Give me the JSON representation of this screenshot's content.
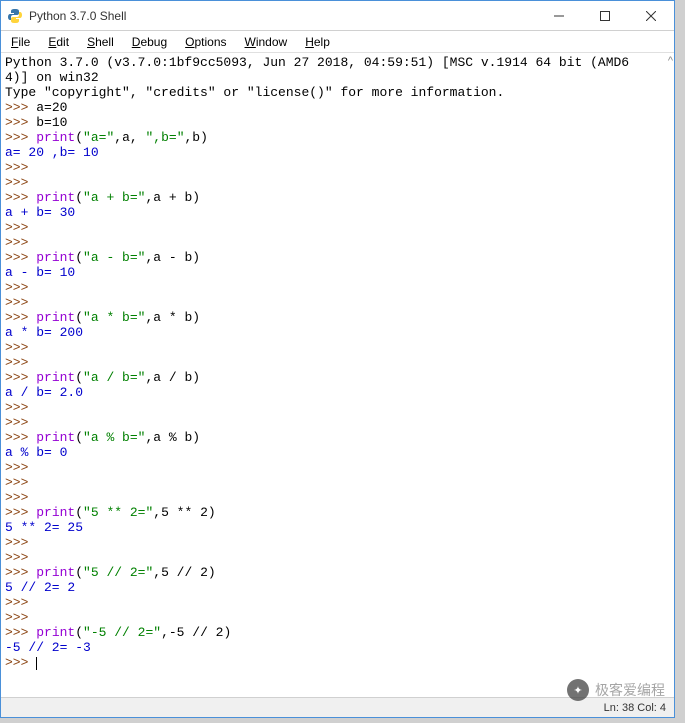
{
  "window": {
    "title": "Python 3.7.0 Shell"
  },
  "menu": {
    "items": [
      {
        "u": "F",
        "rest": "ile"
      },
      {
        "u": "E",
        "rest": "dit"
      },
      {
        "u": "S",
        "rest": "hell"
      },
      {
        "u": "D",
        "rest": "ebug"
      },
      {
        "u": "O",
        "rest": "ptions"
      },
      {
        "u": "W",
        "rest": "indow"
      },
      {
        "u": "H",
        "rest": "elp"
      }
    ]
  },
  "banner": {
    "l1": "Python 3.7.0 (v3.7.0:1bf9cc5093, Jun 27 2018, 04:59:51) [MSC v.1914 64 bit (AMD6",
    "l2": "4)] on win32",
    "l3": "Type \"copyright\", \"credits\" or \"license()\" for more information."
  },
  "session": [
    {
      "t": "in",
      "pre": ">>> ",
      "code": "a=20"
    },
    {
      "t": "in",
      "pre": ">>> ",
      "code": "b=10"
    },
    {
      "t": "in",
      "pre": ">>> ",
      "call": "print",
      "open": "(",
      "s1": "\"a=\"",
      "mid1": ",a, ",
      "s2": "\",b=\"",
      "mid2": ",b",
      "close": ")"
    },
    {
      "t": "out",
      "text": "a= 20 ,b= 10"
    },
    {
      "t": "in",
      "pre": ">>> ",
      "code": ""
    },
    {
      "t": "in",
      "pre": ">>> ",
      "code": ""
    },
    {
      "t": "in",
      "pre": ">>> ",
      "call": "print",
      "open": "(",
      "s1": "\"a + b=\"",
      "mid1": ",a + b",
      "close": ")"
    },
    {
      "t": "out",
      "text": "a + b= 30"
    },
    {
      "t": "in",
      "pre": ">>> ",
      "code": ""
    },
    {
      "t": "in",
      "pre": ">>> ",
      "code": ""
    },
    {
      "t": "in",
      "pre": ">>> ",
      "call": "print",
      "open": "(",
      "s1": "\"a - b=\"",
      "mid1": ",a - b",
      "close": ")"
    },
    {
      "t": "out",
      "text": "a - b= 10"
    },
    {
      "t": "in",
      "pre": ">>> ",
      "code": ""
    },
    {
      "t": "in",
      "pre": ">>> ",
      "code": ""
    },
    {
      "t": "in",
      "pre": ">>> ",
      "call": "print",
      "open": "(",
      "s1": "\"a * b=\"",
      "mid1": ",a * b",
      "close": ")"
    },
    {
      "t": "out",
      "text": "a * b= 200"
    },
    {
      "t": "in",
      "pre": ">>> ",
      "code": ""
    },
    {
      "t": "in",
      "pre": ">>> ",
      "code": ""
    },
    {
      "t": "in",
      "pre": ">>> ",
      "call": "print",
      "open": "(",
      "s1": "\"a / b=\"",
      "mid1": ",a / b",
      "close": ")"
    },
    {
      "t": "out",
      "text": "a / b= 2.0"
    },
    {
      "t": "in",
      "pre": ">>> ",
      "code": ""
    },
    {
      "t": "in",
      "pre": ">>> ",
      "code": ""
    },
    {
      "t": "in",
      "pre": ">>> ",
      "call": "print",
      "open": "(",
      "s1": "\"a % b=\"",
      "mid1": ",a % b",
      "close": ")"
    },
    {
      "t": "out",
      "text": "a % b= 0"
    },
    {
      "t": "in",
      "pre": ">>> ",
      "code": ""
    },
    {
      "t": "in",
      "pre": ">>> ",
      "code": ""
    },
    {
      "t": "in",
      "pre": ">>> ",
      "code": ""
    },
    {
      "t": "in",
      "pre": ">>> ",
      "call": "print",
      "open": "(",
      "s1": "\"5 ** 2=\"",
      "mid1": ",5 ** 2",
      "close": ")"
    },
    {
      "t": "out",
      "text": "5 ** 2= 25"
    },
    {
      "t": "in",
      "pre": ">>> ",
      "code": ""
    },
    {
      "t": "in",
      "pre": ">>> ",
      "code": ""
    },
    {
      "t": "in",
      "pre": ">>> ",
      "call": "print",
      "open": "(",
      "s1": "\"5 // 2=\"",
      "mid1": ",5 // 2",
      "close": ")"
    },
    {
      "t": "out",
      "text": "5 // 2= 2"
    },
    {
      "t": "in",
      "pre": ">>> ",
      "code": ""
    },
    {
      "t": "in",
      "pre": ">>> ",
      "code": ""
    },
    {
      "t": "in",
      "pre": ">>> ",
      "call": "print",
      "open": "(",
      "s1": "\"-5 // 2=\"",
      "mid1": ",-5 // 2",
      "close": ")"
    },
    {
      "t": "out",
      "text": "-5 // 2= -3"
    },
    {
      "t": "cursor",
      "pre": ">>> "
    }
  ],
  "status": {
    "text": "Ln: 38  Col: 4"
  },
  "scrollhint": "^",
  "watermark": {
    "text": "极客爱编程"
  }
}
